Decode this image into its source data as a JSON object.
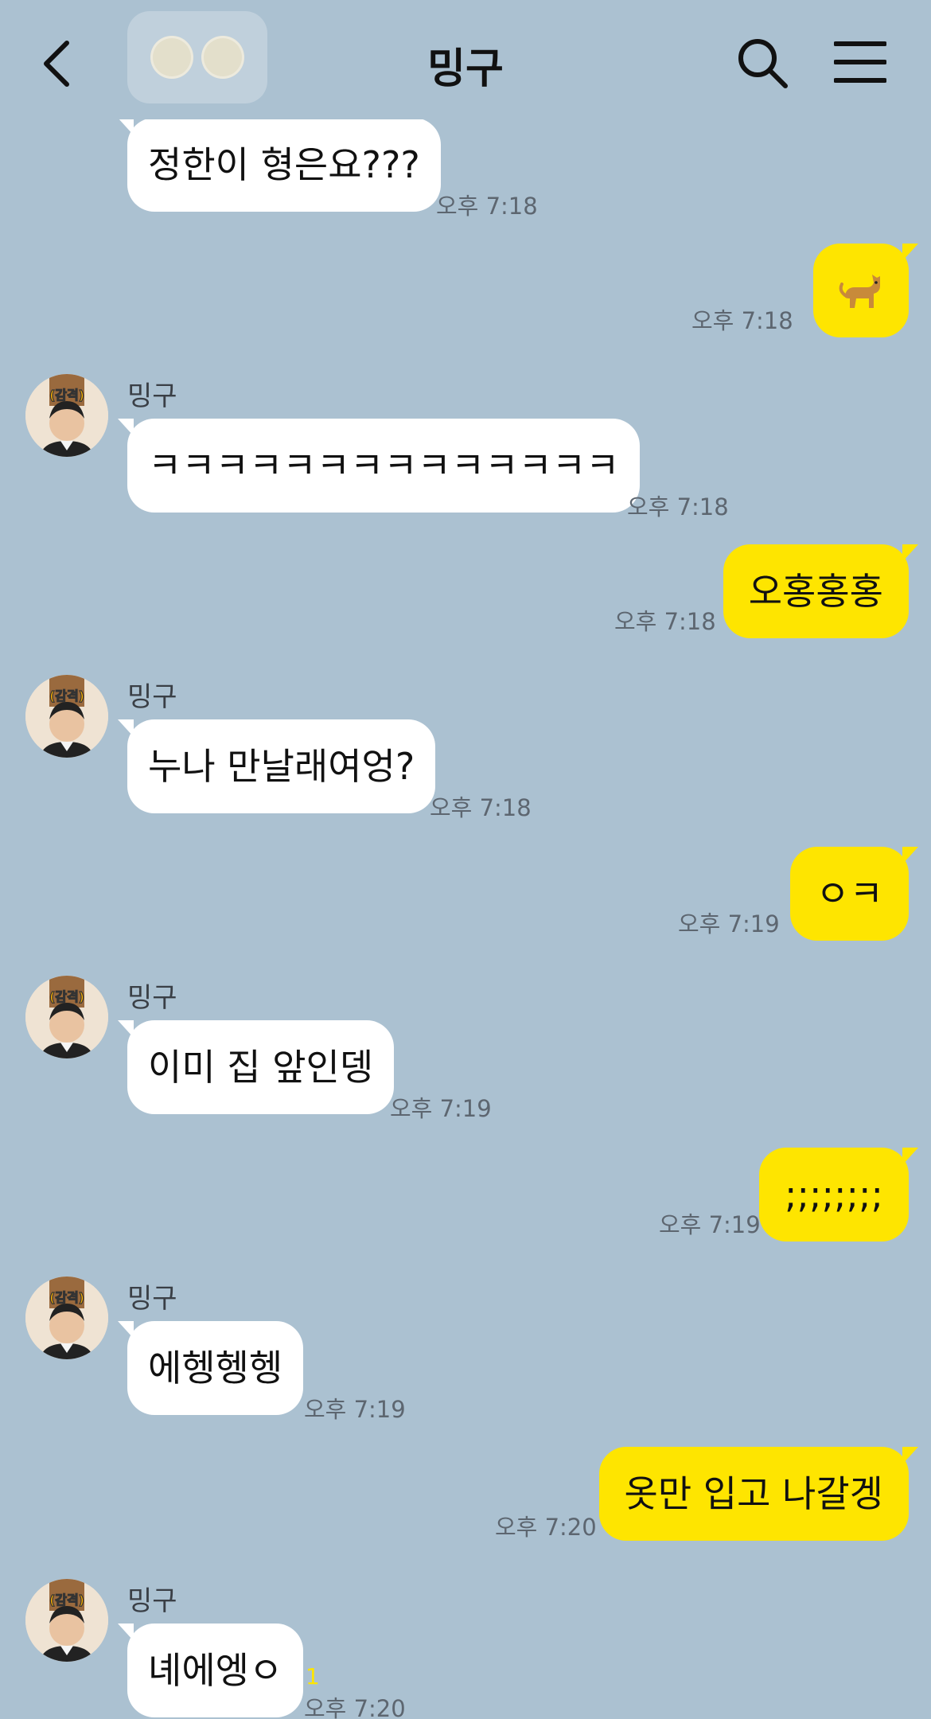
{
  "header": {
    "title": "밍구",
    "back_icon": "chevron-left-icon",
    "search_icon": "search-icon",
    "menu_icon": "hamburger-menu-icon"
  },
  "colors": {
    "background": "#abc1d1",
    "incoming_bubble": "#ffffff",
    "outgoing_bubble": "#fee500",
    "unread": "#fee500"
  },
  "messages": [
    {
      "dir": "in",
      "sender": "",
      "text": "정한이 형은요???",
      "time": "오후 7:18"
    },
    {
      "dir": "out",
      "text": "",
      "emoji": "dog-emoji",
      "time": "오후 7:18"
    },
    {
      "dir": "in",
      "sender": "밍구",
      "text": "ㅋㅋㅋㅋㅋㅋㅋㅋㅋㅋㅋㅋㅋㅋ",
      "time": "오후 7:18"
    },
    {
      "dir": "out",
      "text": "오홍홍홍",
      "time": "오후 7:18"
    },
    {
      "dir": "in",
      "sender": "밍구",
      "text": "누나 만날래여엉?",
      "time": "오후 7:18"
    },
    {
      "dir": "out",
      "text": "ㅇㅋ",
      "time": "오후 7:19"
    },
    {
      "dir": "in",
      "sender": "밍구",
      "text": "이미 집 앞인뎅",
      "time": "오후 7:19"
    },
    {
      "dir": "out",
      "text": ";;;;;;;;",
      "time": "오후 7:19"
    },
    {
      "dir": "in",
      "sender": "밍구",
      "text": "에헹헹헹",
      "time": "오후 7:19"
    },
    {
      "dir": "out",
      "text": "옷만 입고 나갈겡",
      "time": "오후 7:20"
    },
    {
      "dir": "in",
      "sender": "밍구",
      "text": "녜에엥ㅇ",
      "time": "오후 7:20",
      "unread": "1"
    }
  ],
  "avatar_caption": "(감격)"
}
